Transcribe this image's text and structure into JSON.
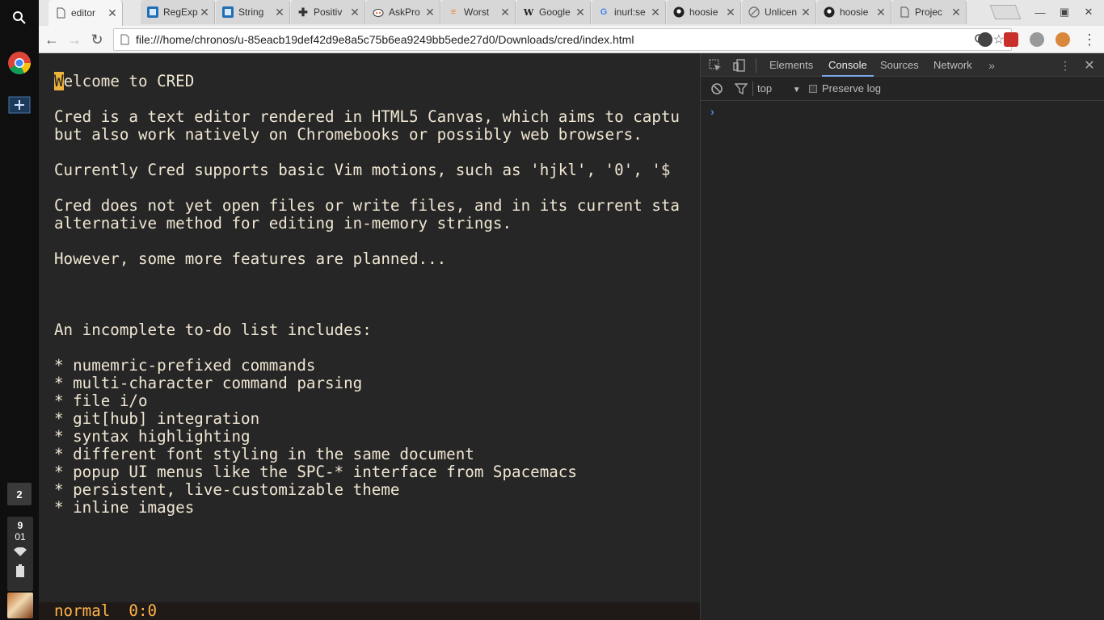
{
  "shelf": {
    "workspace_number": "2",
    "clock_hour": "9",
    "clock_minute": "01"
  },
  "tabs": [
    {
      "title": "editor",
      "icon": "page-icon",
      "active": true
    },
    {
      "title": "RegExp",
      "icon": "regexp-icon"
    },
    {
      "title": "String",
      "icon": "regexp-icon"
    },
    {
      "title": "Positiv",
      "icon": "plus-cross-icon"
    },
    {
      "title": "AskPro",
      "icon": "reddit-icon"
    },
    {
      "title": "Worst",
      "icon": "stackoverflow-icon"
    },
    {
      "title": "Google",
      "icon": "wikipedia-icon"
    },
    {
      "title": "inurl:se",
      "icon": "google-icon"
    },
    {
      "title": "hoosie",
      "icon": "github-icon"
    },
    {
      "title": "Unlicen",
      "icon": "unlicense-icon"
    },
    {
      "title": "hoosie",
      "icon": "github-icon"
    },
    {
      "title": "Projec",
      "icon": "page-icon"
    }
  ],
  "toolbar": {
    "url": "file:///home/chronos/u-85eacb19def42d9e8a5c75b6ea9249bb5ede27d0/Downloads/cred/index.html"
  },
  "editor": {
    "lines": [
      "Welcome to CRED",
      "",
      "Cred is a text editor rendered in HTML5 Canvas, which aims to captu",
      "but also work natively on Chromebooks or possibly web browsers.",
      "",
      "Currently Cred supports basic Vim motions, such as 'hjkl', '0', '$",
      "",
      "Cred does not yet open files or write files, and in its current sta",
      "alternative method for editing in-memory strings.",
      "",
      "However, some more features are planned...",
      "",
      "",
      "",
      "An incomplete to-do list includes:",
      "",
      "* numemric-prefixed commands",
      "* multi-character command parsing",
      "* file i/o",
      "* git[hub] integration",
      "* syntax highlighting",
      "* different font styling in the same document",
      "* popup UI menus like the SPC-* interface from Spacemacs",
      "* persistent, live-customizable theme",
      "* inline images"
    ],
    "cursor_char": "W",
    "status_mode": "normal",
    "status_position": "0:0"
  },
  "devtools": {
    "tabs": [
      "Elements",
      "Console",
      "Sources",
      "Network"
    ],
    "active_tab": "Console",
    "context": "top",
    "preserve_log_label": "Preserve log"
  },
  "colors": {
    "editor_bg": "#262626",
    "editor_text": "#f0e6d2",
    "cursor": "#f0b43c",
    "status_text": "#ffb347"
  }
}
